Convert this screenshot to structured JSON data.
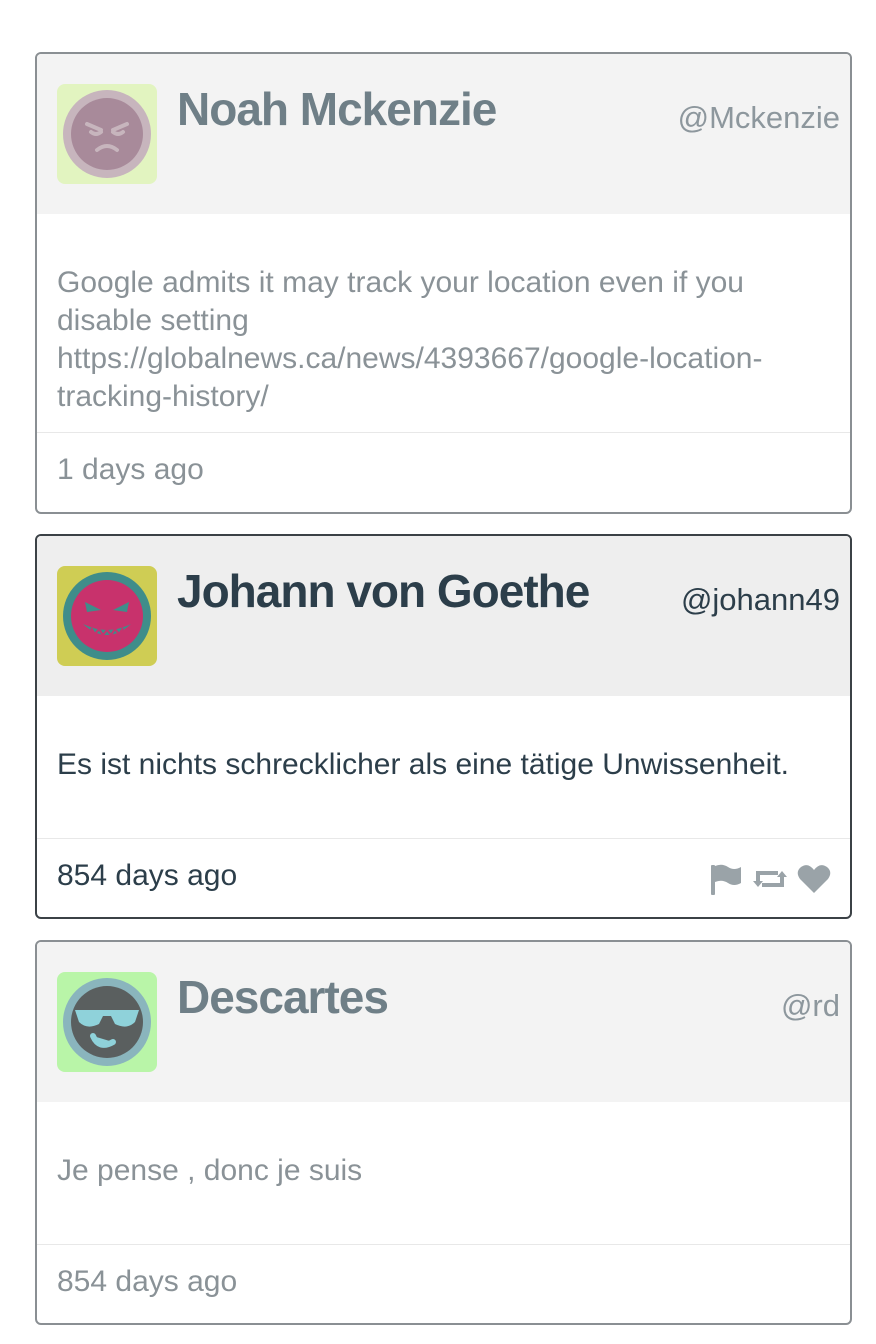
{
  "tweets": [
    {
      "name": "Noah Mckenzie",
      "handle": "@Mckenzie",
      "text": "Google admits it may track your location even if you disable setting https://globalnews.ca/news/4393667/google-location-tracking-history/",
      "time": "1 days ago",
      "avatar_icon": "grumpy-face-icon",
      "avatar_bg": "#e2f4c0",
      "avatar_face": "#a88a9a"
    },
    {
      "name": "Johann von Goethe",
      "handle": "@johann49",
      "text": "Es ist nichts schrecklicher als eine tätige Unwissenheit.",
      "time": "854 days ago",
      "avatar_icon": "evil-grin-face-icon",
      "avatar_bg": "#cfcd54",
      "avatar_face": "#c8326c",
      "actions": [
        "flag-icon",
        "retweet-icon",
        "heart-icon"
      ]
    },
    {
      "name": "Descartes",
      "handle": "@rd",
      "text": "Je pense , donc je suis",
      "time": "854 days ago",
      "avatar_icon": "sunglasses-face-icon",
      "avatar_bg": "#b9f5a8",
      "avatar_face": "#5a5f5f"
    }
  ],
  "colors": {
    "muted_text": "#8a9297",
    "dark_text": "#2c3e4a",
    "icon_gray": "#9aa3a8"
  }
}
